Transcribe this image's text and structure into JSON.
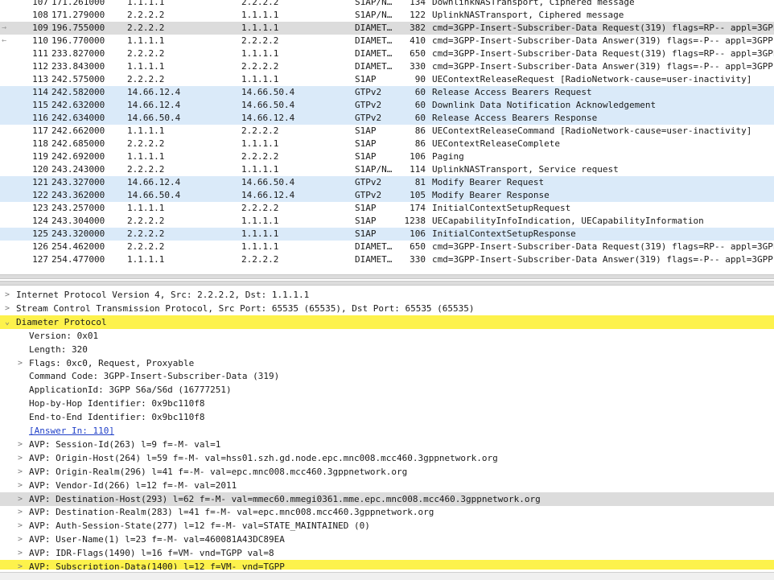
{
  "packet_list": {
    "markers": {
      "request_arrow": "→",
      "response_arrow": "←"
    },
    "rows": [
      {
        "no": "107",
        "time": "171.261000",
        "src": "1.1.1.1",
        "dst": "2.2.2.2",
        "proto": "S1AP/N…",
        "len": "134",
        "info": "DownlinkNASTransport, Ciphered message",
        "bg": "white",
        "marker": ""
      },
      {
        "no": "108",
        "time": "171.279000",
        "src": "2.2.2.2",
        "dst": "1.1.1.1",
        "proto": "S1AP/N…",
        "len": "122",
        "info": "UplinkNASTransport, Ciphered message",
        "bg": "white",
        "marker": ""
      },
      {
        "no": "109",
        "time": "196.755000",
        "src": "2.2.2.2",
        "dst": "1.1.1.1",
        "proto": "DIAMET…",
        "len": "382",
        "info": "cmd=3GPP-Insert-Subscriber-Data Request(319) flags=RP-- appl=3GPP",
        "bg": "sel",
        "marker": "request"
      },
      {
        "no": "110",
        "time": "196.770000",
        "src": "1.1.1.1",
        "dst": "2.2.2.2",
        "proto": "DIAMET…",
        "len": "410",
        "info": "cmd=3GPP-Insert-Subscriber-Data Answer(319) flags=-P-- appl=3GPP",
        "bg": "white",
        "marker": "response"
      },
      {
        "no": "111",
        "time": "233.827000",
        "src": "2.2.2.2",
        "dst": "1.1.1.1",
        "proto": "DIAMET…",
        "len": "650",
        "info": "cmd=3GPP-Insert-Subscriber-Data Request(319) flags=RP-- appl=3GPP",
        "bg": "white",
        "marker": ""
      },
      {
        "no": "112",
        "time": "233.843000",
        "src": "1.1.1.1",
        "dst": "2.2.2.2",
        "proto": "DIAMET…",
        "len": "330",
        "info": "cmd=3GPP-Insert-Subscriber-Data Answer(319) flags=-P-- appl=3GPP",
        "bg": "white",
        "marker": ""
      },
      {
        "no": "113",
        "time": "242.575000",
        "src": "2.2.2.2",
        "dst": "1.1.1.1",
        "proto": "S1AP",
        "len": "90",
        "info": "UEContextReleaseRequest [RadioNetwork-cause=user-inactivity]",
        "bg": "white",
        "marker": ""
      },
      {
        "no": "114",
        "time": "242.582000",
        "src": "14.66.12.4",
        "dst": "14.66.50.4",
        "proto": "GTPv2",
        "len": "60",
        "info": "Release Access Bearers Request",
        "bg": "blue",
        "marker": ""
      },
      {
        "no": "115",
        "time": "242.632000",
        "src": "14.66.12.4",
        "dst": "14.66.50.4",
        "proto": "GTPv2",
        "len": "60",
        "info": "Downlink Data Notification Acknowledgement",
        "bg": "blue",
        "marker": ""
      },
      {
        "no": "116",
        "time": "242.634000",
        "src": "14.66.50.4",
        "dst": "14.66.12.4",
        "proto": "GTPv2",
        "len": "60",
        "info": "Release Access Bearers Response",
        "bg": "blue",
        "marker": ""
      },
      {
        "no": "117",
        "time": "242.662000",
        "src": "1.1.1.1",
        "dst": "2.2.2.2",
        "proto": "S1AP",
        "len": "86",
        "info": "UEContextReleaseCommand [RadioNetwork-cause=user-inactivity]",
        "bg": "white",
        "marker": ""
      },
      {
        "no": "118",
        "time": "242.685000",
        "src": "2.2.2.2",
        "dst": "1.1.1.1",
        "proto": "S1AP",
        "len": "86",
        "info": "UEContextReleaseComplete",
        "bg": "white",
        "marker": ""
      },
      {
        "no": "119",
        "time": "242.692000",
        "src": "1.1.1.1",
        "dst": "2.2.2.2",
        "proto": "S1AP",
        "len": "106",
        "info": "Paging",
        "bg": "white",
        "marker": ""
      },
      {
        "no": "120",
        "time": "243.243000",
        "src": "2.2.2.2",
        "dst": "1.1.1.1",
        "proto": "S1AP/N…",
        "len": "114",
        "info": "UplinkNASTransport, Service request",
        "bg": "white",
        "marker": ""
      },
      {
        "no": "121",
        "time": "243.327000",
        "src": "14.66.12.4",
        "dst": "14.66.50.4",
        "proto": "GTPv2",
        "len": "81",
        "info": "Modify Bearer Request",
        "bg": "blue",
        "marker": ""
      },
      {
        "no": "122",
        "time": "243.362000",
        "src": "14.66.50.4",
        "dst": "14.66.12.4",
        "proto": "GTPv2",
        "len": "105",
        "info": "Modify Bearer Response",
        "bg": "blue",
        "marker": ""
      },
      {
        "no": "123",
        "time": "243.257000",
        "src": "1.1.1.1",
        "dst": "2.2.2.2",
        "proto": "S1AP",
        "len": "174",
        "info": "InitialContextSetupRequest",
        "bg": "white",
        "marker": ""
      },
      {
        "no": "124",
        "time": "243.304000",
        "src": "2.2.2.2",
        "dst": "1.1.1.1",
        "proto": "S1AP",
        "len": "1238",
        "info": "UECapabilityInfoIndication, UECapabilityInformation",
        "bg": "white",
        "marker": ""
      },
      {
        "no": "125",
        "time": "243.320000",
        "src": "2.2.2.2",
        "dst": "1.1.1.1",
        "proto": "S1AP",
        "len": "106",
        "info": "InitialContextSetupResponse",
        "bg": "blue",
        "marker": ""
      },
      {
        "no": "126",
        "time": "254.462000",
        "src": "2.2.2.2",
        "dst": "1.1.1.1",
        "proto": "DIAMET…",
        "len": "650",
        "info": "cmd=3GPP-Insert-Subscriber-Data Request(319) flags=RP-- appl=3GPP",
        "bg": "white",
        "marker": ""
      },
      {
        "no": "127",
        "time": "254.477000",
        "src": "1.1.1.1",
        "dst": "2.2.2.2",
        "proto": "DIAMET…",
        "len": "330",
        "info": "cmd=3GPP-Insert-Subscriber-Data Answer(319) flags=-P-- appl=3GPP",
        "bg": "white",
        "marker": ""
      }
    ]
  },
  "details": {
    "twisty_collapsed": ">",
    "twisty_expanded": "⌄",
    "lines": [
      {
        "text": "Internet Protocol Version 4, Src: 2.2.2.2, Dst: 1.1.1.1",
        "indent": 0,
        "twisty": "collapsed",
        "hl": "",
        "link": false
      },
      {
        "text": "Stream Control Transmission Protocol, Src Port: 65535 (65535), Dst Port: 65535 (65535)",
        "indent": 0,
        "twisty": "collapsed",
        "hl": "",
        "link": false
      },
      {
        "text": "Diameter Protocol",
        "indent": 0,
        "twisty": "expanded",
        "hl": "yellow",
        "link": false
      },
      {
        "text": "Version: 0x01",
        "indent": 1,
        "twisty": "",
        "hl": "",
        "link": false
      },
      {
        "text": "Length: 320",
        "indent": 1,
        "twisty": "",
        "hl": "",
        "link": false
      },
      {
        "text": "Flags: 0xc0, Request, Proxyable",
        "indent": 1,
        "twisty": "collapsed",
        "hl": "",
        "link": false
      },
      {
        "text": "Command Code: 3GPP-Insert-Subscriber-Data (319)",
        "indent": 1,
        "twisty": "",
        "hl": "",
        "link": false
      },
      {
        "text": "ApplicationId: 3GPP S6a/S6d (16777251)",
        "indent": 1,
        "twisty": "",
        "hl": "",
        "link": false
      },
      {
        "text": "Hop-by-Hop Identifier: 0x9bc110f8",
        "indent": 1,
        "twisty": "",
        "hl": "",
        "link": false
      },
      {
        "text": "End-to-End Identifier: 0x9bc110f8",
        "indent": 1,
        "twisty": "",
        "hl": "",
        "link": false
      },
      {
        "text": "[Answer In: 110]",
        "indent": 1,
        "twisty": "",
        "hl": "",
        "link": true
      },
      {
        "text": "AVP: Session-Id(263) l=9 f=-M- val=1",
        "indent": 1,
        "twisty": "collapsed",
        "hl": "",
        "link": false
      },
      {
        "text": "AVP: Origin-Host(264) l=59 f=-M- val=hss01.szh.gd.node.epc.mnc008.mcc460.3gppnetwork.org",
        "indent": 1,
        "twisty": "collapsed",
        "hl": "",
        "link": false
      },
      {
        "text": "AVP: Origin-Realm(296) l=41 f=-M- val=epc.mnc008.mcc460.3gppnetwork.org",
        "indent": 1,
        "twisty": "collapsed",
        "hl": "",
        "link": false
      },
      {
        "text": "AVP: Vendor-Id(266) l=12 f=-M- val=2011",
        "indent": 1,
        "twisty": "collapsed",
        "hl": "",
        "link": false
      },
      {
        "text": "AVP: Destination-Host(293) l=62 f=-M- val=mmec60.mmegi0361.mme.epc.mnc008.mcc460.3gppnetwork.org",
        "indent": 1,
        "twisty": "collapsed",
        "hl": "gray",
        "link": false
      },
      {
        "text": "AVP: Destination-Realm(283) l=41 f=-M- val=epc.mnc008.mcc460.3gppnetwork.org",
        "indent": 1,
        "twisty": "collapsed",
        "hl": "",
        "link": false
      },
      {
        "text": "AVP: Auth-Session-State(277) l=12 f=-M- val=STATE_MAINTAINED (0)",
        "indent": 1,
        "twisty": "collapsed",
        "hl": "",
        "link": false
      },
      {
        "text": "AVP: User-Name(1) l=23 f=-M- val=460081A43DC89EA",
        "indent": 1,
        "twisty": "collapsed",
        "hl": "",
        "link": false
      },
      {
        "text": "AVP: IDR-Flags(1490) l=16 f=VM- vnd=TGPP val=8",
        "indent": 1,
        "twisty": "collapsed",
        "hl": "",
        "link": false
      },
      {
        "text": "AVP: Subscription-Data(1400) l=12 f=VM- vnd=TGPP",
        "indent": 1,
        "twisty": "collapsed",
        "hl": "yellow",
        "link": false
      }
    ]
  }
}
